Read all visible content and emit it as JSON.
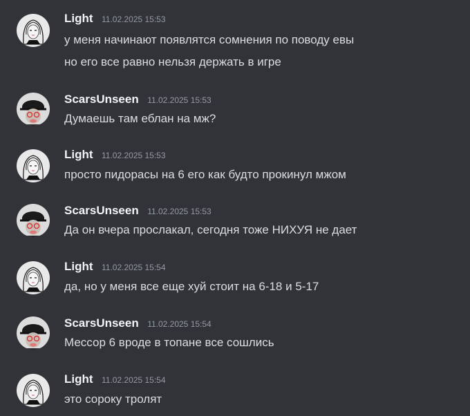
{
  "messages": [
    {
      "author": "Light",
      "avatar": "light-avatar",
      "timestamp": "11.02.2025 15:53",
      "lines": [
        "у меня начинают появлятся сомнения по поводу евы",
        "но его все равно нельзя держать в игре"
      ]
    },
    {
      "author": "ScarsUnseen",
      "avatar": "scarsunseen-avatar",
      "timestamp": "11.02.2025 15:53",
      "lines": [
        "Думаешь там еблан на мж?"
      ]
    },
    {
      "author": "Light",
      "avatar": "light-avatar",
      "timestamp": "11.02.2025 15:53",
      "lines": [
        "просто пидорасы на 6 его как будто прокинул мжом"
      ]
    },
    {
      "author": "ScarsUnseen",
      "avatar": "scarsunseen-avatar",
      "timestamp": "11.02.2025 15:53",
      "lines": [
        "Да он вчера прослакал, сегодня тоже НИХУЯ не дает"
      ]
    },
    {
      "author": "Light",
      "avatar": "light-avatar",
      "timestamp": "11.02.2025 15:54",
      "lines": [
        "да, но у меня все еще хуй стоит на 6-18 и 5-17"
      ]
    },
    {
      "author": "ScarsUnseen",
      "avatar": "scarsunseen-avatar",
      "timestamp": "11.02.2025 15:54",
      "lines": [
        "Мессор 6 вроде в топане все сошлись"
      ]
    },
    {
      "author": "Light",
      "avatar": "light-avatar",
      "timestamp": "11.02.2025 15:54",
      "lines": [
        "это сороку тролят"
      ]
    }
  ]
}
